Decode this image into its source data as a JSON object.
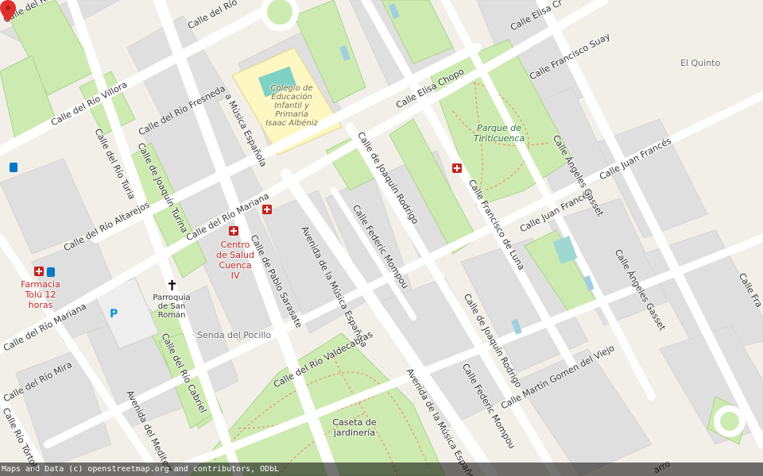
{
  "map": {
    "attribution": "Maps and Data (c) openstreetmap.org and contributors, ODbL",
    "colors": {
      "background": "#f2efe9",
      "block": "#e0dfdf",
      "road": "#ffffff",
      "road_edge": "#c9c4bc",
      "park": "#cdebb0",
      "park_path": "#f48d6b",
      "school": "#fff7c2",
      "parking": "#eeeeee",
      "marker": "#e0302b",
      "poi_health": "#c2251f",
      "poi_park": "#6b4a1a"
    },
    "streets": [
      "Calle del Río Villora",
      "Calle del Río",
      "Calle del Río Fresneda",
      "Calle del Río Turia",
      "Calle de Joaquín Turina",
      "Calle del Río Mariana",
      "Calle del Río Altarejos",
      "Calle de Pablo Sarasate",
      "Avenida de la Música Española",
      "Calle Federic Mompou",
      "Calle de Joaquín Rodrigo",
      "Calle Elisa Chopo",
      "Calle Elisa Cr",
      "Calle Francisco Suay",
      "Calle Francisco de Luna",
      "Calle Juan Francés",
      "Calle Ángeles Gasset",
      "Calle Martín Gomen del Viejo",
      "Calle del Río Valdecabras",
      "Calle del Río Cabriel",
      "Calle del Río Mira",
      "Calle Río Tórtola",
      "Avenida del Mediterr",
      "a Música Española",
      "Calle Fra",
      "arro"
    ],
    "places": {
      "school": "Colegio de Educación Infantil y Primaria Isaac Albéniz",
      "park": "Parque de Tiriticuenca",
      "health_center": "Centro de Salud Cuenca IV",
      "church": "Parroquia de San Román",
      "pharmacy": "Farmacia Tolú 12 horas",
      "area": "Senda del Pocillo",
      "caseta": "Caseta de jardinería",
      "el_quinto": "El Quinto"
    }
  }
}
